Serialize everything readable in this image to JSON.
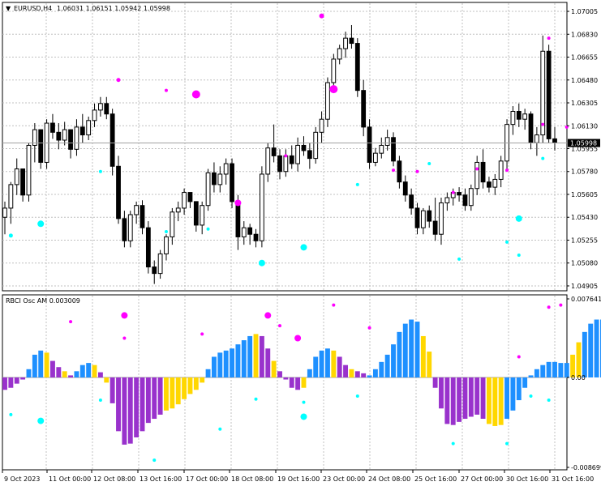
{
  "header": {
    "symbol": "EURUSD,H4",
    "ohlc": "1.06031 1.06151 1.05942 1.05998"
  },
  "indicator": {
    "label": "RBCI Osc AM 0.003009"
  },
  "colors": {
    "bull_candle": "#ffffff",
    "bear_candle": "#000000",
    "osc_blue": "#1e90ff",
    "osc_purple": "#9932cc",
    "osc_gold": "#ffd700",
    "dot_magenta": "#ff00ff",
    "dot_cyan": "#00ffff",
    "grid": "#c0c0c0",
    "price_line": "#a0a0a0",
    "current_price_box": "#000000"
  },
  "chart_data": [
    {
      "type": "candlestick",
      "title": "EURUSD,H4",
      "y_ticks": [
        "1.07005",
        "1.06830",
        "1.06655",
        "1.06480",
        "1.06305",
        "1.06130",
        "1.05955",
        "1.05780",
        "1.05605",
        "1.05430",
        "1.05255",
        "1.05080",
        "1.04905"
      ],
      "current_price": "1.05998",
      "ylim": [
        1.0488,
        1.0703
      ],
      "x_ticks": [
        "9 Oct 2023",
        "11 Oct 00:00",
        "12 Oct 08:00",
        "13 Oct 16:00",
        "17 Oct 00:00",
        "18 Oct 08:00",
        "19 Oct 16:00",
        "23 Oct 00:00",
        "24 Oct 08:00",
        "25 Oct 16:00",
        "27 Oct 00:00",
        "30 Oct 16:00",
        "31 Oct 16:00"
      ],
      "candles": [
        [
          1.0543,
          1.0555,
          1.053,
          1.055
        ],
        [
          1.055,
          1.057,
          1.0538,
          1.0568
        ],
        [
          1.0568,
          1.0588,
          1.056,
          1.058
        ],
        [
          1.058,
          1.0572,
          1.0555,
          1.056
        ],
        [
          1.056,
          1.06,
          1.0555,
          1.0598
        ],
        [
          1.0598,
          1.0615,
          1.0585,
          1.061
        ],
        [
          1.061,
          1.06,
          1.058,
          1.0585
        ],
        [
          1.0585,
          1.0618,
          1.058,
          1.0615
        ],
        [
          1.0615,
          1.0622,
          1.0603,
          1.0608
        ],
        [
          1.0608,
          1.0615,
          1.0595,
          1.0602
        ],
        [
          1.0602,
          1.0616,
          1.0598,
          1.061
        ],
        [
          1.061,
          1.06,
          1.0588,
          1.0595
        ],
        [
          1.0595,
          1.0618,
          1.059,
          1.0612
        ],
        [
          1.0612,
          1.0622,
          1.06,
          1.0606
        ],
        [
          1.0606,
          1.062,
          1.0602,
          1.0617
        ],
        [
          1.0617,
          1.063,
          1.0612,
          1.0625
        ],
        [
          1.0625,
          1.0635,
          1.062,
          1.063
        ],
        [
          1.063,
          1.0635,
          1.0618,
          1.0622
        ],
        [
          1.0622,
          1.0626,
          1.0575,
          1.0582
        ],
        [
          1.0582,
          1.059,
          1.0538,
          1.0542
        ],
        [
          1.0542,
          1.0548,
          1.052,
          1.0525
        ],
        [
          1.0525,
          1.0548,
          1.052,
          1.0545
        ],
        [
          1.0545,
          1.0555,
          1.0538,
          1.0552
        ],
        [
          1.0552,
          1.0556,
          1.053,
          1.0535
        ],
        [
          1.0535,
          1.054,
          1.05,
          1.0505
        ],
        [
          1.0505,
          1.051,
          1.0492,
          1.05
        ],
        [
          1.05,
          1.0518,
          1.0496,
          1.0515
        ],
        [
          1.0515,
          1.053,
          1.051,
          1.0528
        ],
        [
          1.0528,
          1.055,
          1.0522,
          1.0547
        ],
        [
          1.0547,
          1.0555,
          1.054,
          1.055
        ],
        [
          1.055,
          1.0565,
          1.0545,
          1.0562
        ],
        [
          1.0562,
          1.0562,
          1.055,
          1.0555
        ],
        [
          1.0555,
          1.055,
          1.0532,
          1.0537
        ],
        [
          1.0537,
          1.0555,
          1.053,
          1.0552
        ],
        [
          1.0552,
          1.058,
          1.0548,
          1.0577
        ],
        [
          1.0577,
          1.0585,
          1.0562,
          1.0568
        ],
        [
          1.0568,
          1.0582,
          1.0562,
          1.0576
        ],
        [
          1.0576,
          1.0588,
          1.0568,
          1.0584
        ],
        [
          1.0584,
          1.0588,
          1.055,
          1.0555
        ],
        [
          1.0555,
          1.056,
          1.0518,
          1.0528
        ],
        [
          1.0528,
          1.054,
          1.0522,
          1.0535
        ],
        [
          1.0535,
          1.0538,
          1.0522,
          1.053
        ],
        [
          1.053,
          1.0534,
          1.052,
          1.0525
        ],
        [
          1.0525,
          1.0582,
          1.052,
          1.0576
        ],
        [
          1.0576,
          1.06,
          1.057,
          1.0596
        ],
        [
          1.0596,
          1.0614,
          1.0585,
          1.059
        ],
        [
          1.059,
          1.0595,
          1.0572,
          1.0578
        ],
        [
          1.0578,
          1.0595,
          1.0574,
          1.059
        ],
        [
          1.059,
          1.0598,
          1.058,
          1.0584
        ],
        [
          1.0584,
          1.0604,
          1.0578,
          1.0598
        ],
        [
          1.0598,
          1.0605,
          1.059,
          1.0594
        ],
        [
          1.0594,
          1.06,
          1.058,
          1.0588
        ],
        [
          1.0588,
          1.0612,
          1.0584,
          1.0608
        ],
        [
          1.0608,
          1.0624,
          1.06,
          1.0618
        ],
        [
          1.0618,
          1.065,
          1.0612,
          1.0646
        ],
        [
          1.0646,
          1.0668,
          1.064,
          1.0664
        ],
        [
          1.0664,
          1.0675,
          1.066,
          1.0672
        ],
        [
          1.0672,
          1.0685,
          1.0665,
          1.068
        ],
        [
          1.068,
          1.069,
          1.0672,
          1.0676
        ],
        [
          1.0676,
          1.068,
          1.0635,
          1.064
        ],
        [
          1.064,
          1.0648,
          1.0605,
          1.0612
        ],
        [
          1.0612,
          1.0618,
          1.058,
          1.0585
        ],
        [
          1.0585,
          1.0596,
          1.0582,
          1.0592
        ],
        [
          1.0592,
          1.0604,
          1.0588,
          1.0598
        ],
        [
          1.0598,
          1.061,
          1.0594,
          1.0604
        ],
        [
          1.0604,
          1.0608,
          1.0582,
          1.0586
        ],
        [
          1.0586,
          1.059,
          1.0565,
          1.057
        ],
        [
          1.057,
          1.0575,
          1.0555,
          1.056
        ],
        [
          1.056,
          1.0565,
          1.0545,
          1.055
        ],
        [
          1.055,
          1.0554,
          1.053,
          1.0535
        ],
        [
          1.0535,
          1.055,
          1.053,
          1.0548
        ],
        [
          1.0548,
          1.0552,
          1.0535,
          1.054
        ],
        [
          1.054,
          1.0558,
          1.0525,
          1.053
        ],
        [
          1.053,
          1.0558,
          1.0522,
          1.0554
        ],
        [
          1.0554,
          1.0562,
          1.0548,
          1.0558
        ],
        [
          1.0558,
          1.0565,
          1.0552,
          1.0562
        ],
        [
          1.0562,
          1.0566,
          1.0555,
          1.056
        ],
        [
          1.056,
          1.0565,
          1.0548,
          1.0552
        ],
        [
          1.0552,
          1.0568,
          1.0548,
          1.0565
        ],
        [
          1.0565,
          1.059,
          1.056,
          1.0585
        ],
        [
          1.0585,
          1.0595,
          1.0565,
          1.057
        ],
        [
          1.057,
          1.0574,
          1.0562,
          1.0566
        ],
        [
          1.0566,
          1.0576,
          1.056,
          1.0572
        ],
        [
          1.0572,
          1.059,
          1.0566,
          1.0586
        ],
        [
          1.0586,
          1.0618,
          1.058,
          1.0614
        ],
        [
          1.0614,
          1.0628,
          1.0606,
          1.0624
        ],
        [
          1.0624,
          1.063,
          1.0612,
          1.0618
        ],
        [
          1.0618,
          1.0626,
          1.061,
          1.0622
        ],
        [
          1.0622,
          1.0624,
          1.0595,
          1.06
        ],
        [
          1.06,
          1.0612,
          1.059,
          1.0606
        ],
        [
          1.0606,
          1.0682,
          1.06,
          1.067
        ],
        [
          1.067,
          1.0675,
          1.06,
          1.0603
        ],
        [
          1.0603,
          1.0612,
          1.0594,
          1.06
        ]
      ]
    },
    {
      "type": "bar",
      "title": "RBCI Osc AM 0.003009",
      "y_ticks": [
        "0.007641",
        "0.00",
        "-0.008699"
      ],
      "ylim": [
        -0.0087,
        0.0076
      ],
      "values": [
        -0.0012,
        -0.001,
        -0.0006,
        -0.0002,
        0.0008,
        0.0022,
        0.0026,
        0.0024,
        0.0016,
        0.001,
        0.0006,
        0.0002,
        0.0006,
        0.0012,
        0.0014,
        0.0012,
        0.0005,
        -0.0005,
        -0.0025,
        -0.0052,
        -0.0065,
        -0.0064,
        -0.0058,
        -0.0052,
        -0.0044,
        -0.004,
        -0.0036,
        -0.0032,
        -0.003,
        -0.0026,
        -0.0021,
        -0.0016,
        -0.0012,
        -0.0005,
        0.0008,
        0.002,
        0.0024,
        0.0026,
        0.0028,
        0.0032,
        0.0036,
        0.004,
        0.0042,
        0.004,
        0.0028,
        0.0016,
        0.0006,
        -0.0002,
        -0.001,
        -0.0012,
        -0.001,
        0.0008,
        0.002,
        0.0026,
        0.0028,
        0.0026,
        0.002,
        0.0012,
        0.0008,
        0.0006,
        0.0004,
        0.0002,
        0.0008,
        0.0015,
        0.0022,
        0.0032,
        0.0044,
        0.0052,
        0.0056,
        0.0054,
        0.004,
        0.0025,
        -0.001,
        -0.003,
        -0.0045,
        -0.0046,
        -0.0043,
        -0.004,
        -0.0038,
        -0.0036,
        -0.004,
        -0.0045,
        -0.0047,
        -0.0046,
        -0.004,
        -0.0032,
        -0.0022,
        -0.001,
        0.0002,
        0.0008,
        0.0012,
        0.0015,
        0.0015,
        0.0014,
        0.0014,
        0.0022,
        0.0034,
        0.0044,
        0.0052,
        0.0056,
        0.0056,
        0.0054,
        0.0036
      ],
      "color_codes": "ppppbbbgppgpbbbgpgpppppppppgggggggbbbbbbbbgppgppppgbbbbgppgppbbbbbbbbbggpppppppppgggbbbbbbbbbbbgg"
    }
  ],
  "markers": {
    "price_magenta": [
      [
        32,
        1.0637,
        5
      ],
      [
        27,
        1.064,
        2
      ],
      [
        53,
        1.0697,
        3
      ],
      [
        19,
        1.0648,
        2.5
      ],
      [
        47,
        1.059,
        2
      ],
      [
        75,
        1.0562,
        2
      ],
      [
        79,
        1.058,
        2
      ],
      [
        91,
        1.068,
        2
      ],
      [
        90,
        1.0614,
        2
      ],
      [
        55,
        1.0641,
        5
      ],
      [
        69,
        1.0578,
        2
      ],
      [
        65,
        1.0579,
        2
      ],
      [
        94,
        1.0612,
        2
      ],
      [
        39,
        1.0554,
        4
      ],
      [
        84,
        1.0579,
        2
      ]
    ],
    "price_cyan": [
      [
        1,
        1.0529,
        2.5
      ],
      [
        6,
        1.0538,
        4
      ],
      [
        16,
        1.0578,
        2
      ],
      [
        50,
        1.052,
        4
      ],
      [
        27,
        1.0532,
        2
      ],
      [
        34,
        1.0534,
        2
      ],
      [
        59,
        1.0568,
        2
      ],
      [
        71,
        1.0584,
        2
      ],
      [
        86,
        1.0514,
        2
      ],
      [
        84,
        1.0524,
        2
      ],
      [
        86,
        1.0542,
        4
      ],
      [
        90,
        1.0588,
        2
      ],
      [
        43,
        1.0508,
        4
      ],
      [
        76,
        1.0511,
        2
      ]
    ],
    "osc_magenta": [
      [
        11,
        0.0054,
        2
      ],
      [
        20,
        0.006,
        4
      ],
      [
        20,
        0.0038,
        2
      ],
      [
        44,
        0.006,
        4
      ],
      [
        46,
        0.005,
        2
      ],
      [
        33,
        0.0042,
        2
      ],
      [
        49,
        0.0038,
        4
      ],
      [
        55,
        0.007,
        2
      ],
      [
        61,
        0.0048,
        2
      ],
      [
        91,
        0.0068,
        2
      ],
      [
        93,
        0.007,
        2
      ],
      [
        86,
        0.002,
        2
      ]
    ],
    "osc_cyan": [
      [
        1,
        -0.0036,
        2
      ],
      [
        6,
        -0.0042,
        4
      ],
      [
        16,
        -0.0022,
        2
      ],
      [
        25,
        -0.008,
        2
      ],
      [
        36,
        -0.005,
        2
      ],
      [
        42,
        -0.0021,
        2
      ],
      [
        50,
        -0.0038,
        4
      ],
      [
        50,
        -0.0024,
        2
      ],
      [
        59,
        -0.0018,
        2
      ],
      [
        75,
        -0.0064,
        2
      ],
      [
        84,
        -0.0064,
        2
      ],
      [
        88,
        -0.0018,
        2
      ],
      [
        91,
        -0.0022,
        2
      ]
    ]
  }
}
